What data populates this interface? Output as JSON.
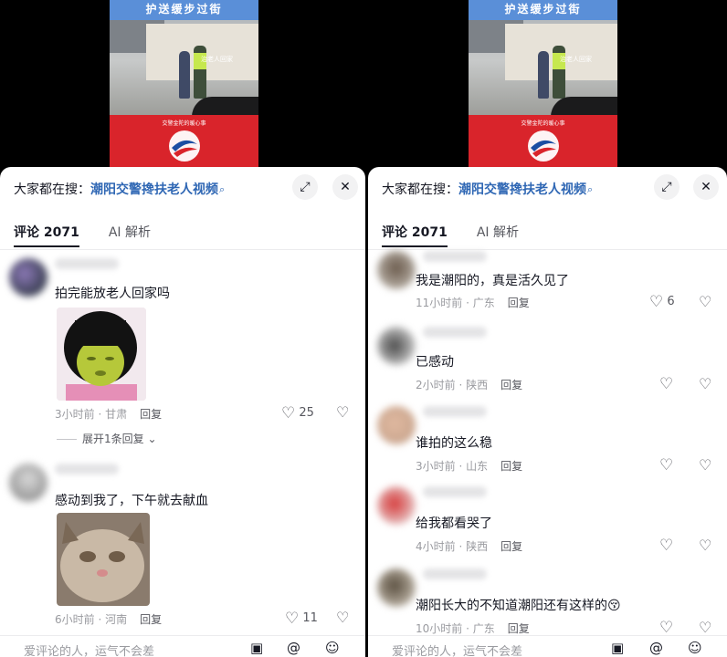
{
  "video": {
    "caption": "护送缓步过街",
    "overlay_text": "治老人回家",
    "banner_text": "交警金陀的暖心事",
    "logo_text": "南方法治报"
  },
  "left": {
    "search": {
      "prefix": "大家都在搜：",
      "query": "潮阳交警搀扶老人视频"
    },
    "tabs": [
      {
        "label": "评论 2071"
      },
      {
        "label": "AI 解析"
      }
    ],
    "comments": [
      {
        "text": "拍完能放老人回家吗",
        "time": "3小时前 · 甘肃",
        "reply": "回复",
        "likes": "25"
      },
      {
        "text": "感动到我了，下午就去献血",
        "time": "6小时前 · 河南",
        "reply": "回复",
        "likes": "11"
      }
    ],
    "expand_replies": "展开1条回复",
    "input_placeholder": "爱评论的人，运气不会差"
  },
  "right": {
    "search": {
      "prefix": "大家都在搜：",
      "query": "潮阳交警搀扶老人视频"
    },
    "tabs": [
      {
        "label": "评论 2071"
      },
      {
        "label": "AI 解析"
      }
    ],
    "comments": [
      {
        "text": "我是潮阳的，真是活久见了",
        "time": "11小时前 · 广东",
        "reply": "回复",
        "likes": "6"
      },
      {
        "text": "已感动",
        "time": "2小时前 · 陕西",
        "reply": "回复",
        "likes": ""
      },
      {
        "text": "谁拍的这么稳",
        "time": "3小时前 · 山东",
        "reply": "回复",
        "likes": ""
      },
      {
        "text": "给我都看哭了",
        "time": "4小时前 · 陕西",
        "reply": "回复",
        "likes": ""
      },
      {
        "text": "潮阳长大的不知道潮阳还有这样的😚",
        "time": "10小时前 · 广东",
        "reply": "回复",
        "likes": ""
      }
    ],
    "input_placeholder": "爱评论的人，运气不会差"
  },
  "icons": {
    "expand": "expand-icon",
    "close": "close-icon",
    "search": "search-icon",
    "heart": "heart-icon",
    "dislike": "broken-heart-icon",
    "image": "image-icon",
    "mention": "at-icon",
    "emoji": "emoji-icon"
  }
}
